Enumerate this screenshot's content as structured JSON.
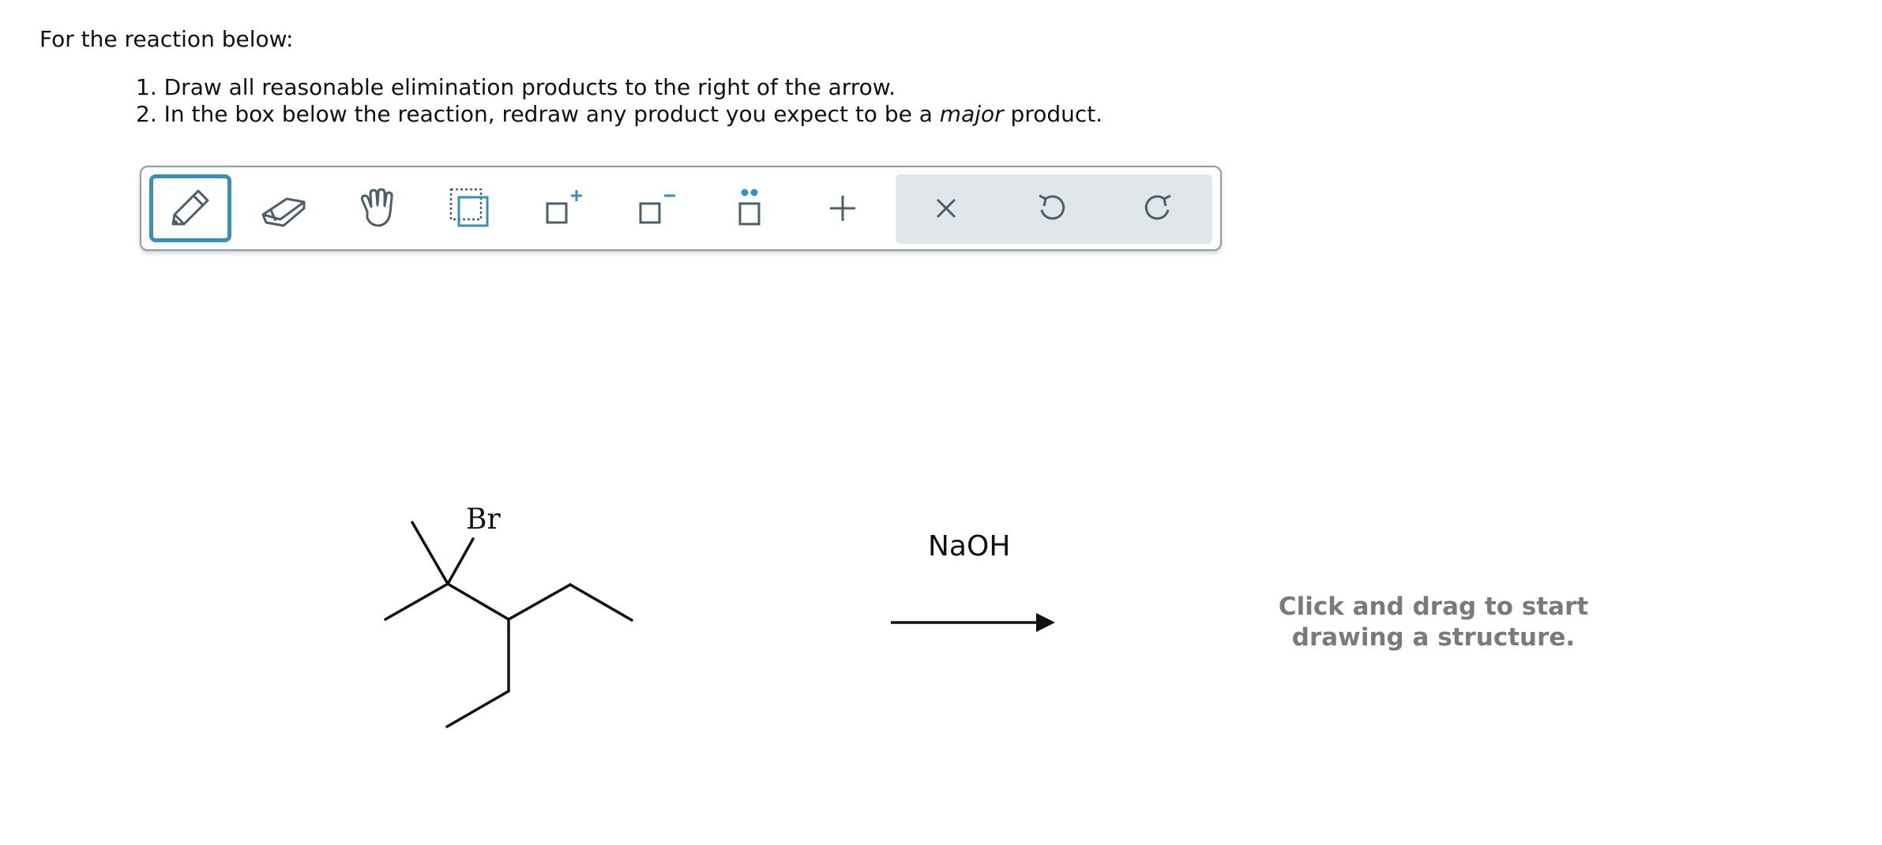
{
  "question": {
    "intro": "For the reaction below:",
    "steps": [
      "1. Draw all reasonable elimination products to the right of the arrow.",
      {
        "before": "2. In the box below the reaction, redraw any product you expect to be a ",
        "emphasis": "major",
        "after": " product."
      }
    ]
  },
  "toolbar": {
    "tools": [
      {
        "icon": "pencil-icon",
        "active": true
      },
      {
        "icon": "eraser-icon",
        "active": false
      },
      {
        "icon": "hand-icon",
        "active": false
      },
      {
        "icon": "select-box-icon",
        "active": false
      },
      {
        "icon": "increase-charge-icon",
        "active": false
      },
      {
        "icon": "decrease-charge-icon",
        "active": false
      },
      {
        "icon": "lone-pair-icon",
        "active": false
      },
      {
        "icon": "plus-icon",
        "active": false
      },
      {
        "icon": "clear-icon",
        "active": false
      },
      {
        "icon": "undo-icon",
        "active": false
      },
      {
        "icon": "redo-icon",
        "active": false
      }
    ],
    "colors": {
      "accent": "#3a8fb7",
      "icon": "#4b5f6a",
      "group_bg": "#e1e6ea"
    }
  },
  "reaction": {
    "reactant_atom_label": "Br",
    "reagent": "NaOH",
    "drop_hint_line1": "Click and drag to start",
    "drop_hint_line2": "drawing a structure."
  }
}
